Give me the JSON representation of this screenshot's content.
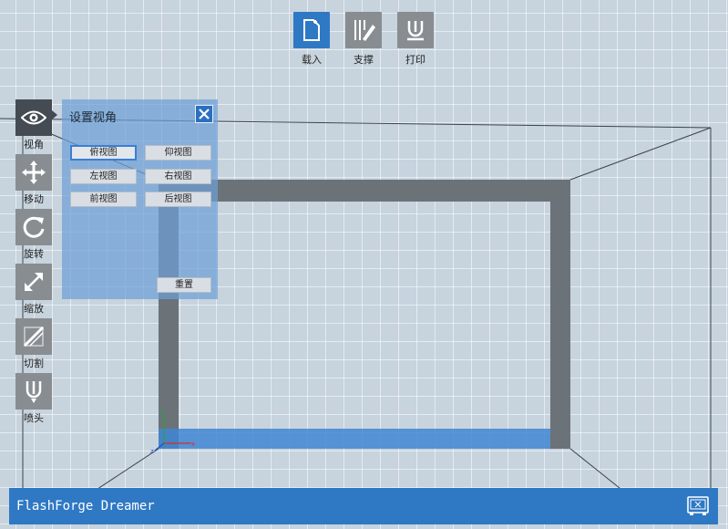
{
  "toolbar_top": {
    "items": [
      {
        "label": "载入",
        "icon": "load-file-icon",
        "color": "#2f78c4"
      },
      {
        "label": "支撑",
        "icon": "support-icon",
        "color": "#888d92"
      },
      {
        "label": "打印",
        "icon": "print-icon",
        "color": "#888d92"
      }
    ]
  },
  "toolbar_left": {
    "items": [
      {
        "label": "视角",
        "icon": "eye-icon",
        "active": true
      },
      {
        "label": "移动",
        "icon": "move-icon"
      },
      {
        "label": "旋转",
        "icon": "rotate-icon"
      },
      {
        "label": "缩放",
        "icon": "scale-icon"
      },
      {
        "label": "切割",
        "icon": "cut-icon"
      },
      {
        "label": "喷头",
        "icon": "nozzle-icon"
      }
    ]
  },
  "view_panel": {
    "title": "设置视角",
    "buttons": {
      "top": "俯视图",
      "bottom": "仰视图",
      "left": "左视图",
      "right": "右视图",
      "front": "前视图",
      "back": "后视图",
      "reset": "重置"
    },
    "selected": "top"
  },
  "status_bar": {
    "app_name": "FlashForge Dreamer"
  },
  "axes": {
    "x": "x",
    "y": "y",
    "z": "z"
  },
  "colors": {
    "accent": "#2f78c4",
    "panel": "#6ea0d7",
    "frame": "#6b7278",
    "background": "#c7d3dd"
  }
}
